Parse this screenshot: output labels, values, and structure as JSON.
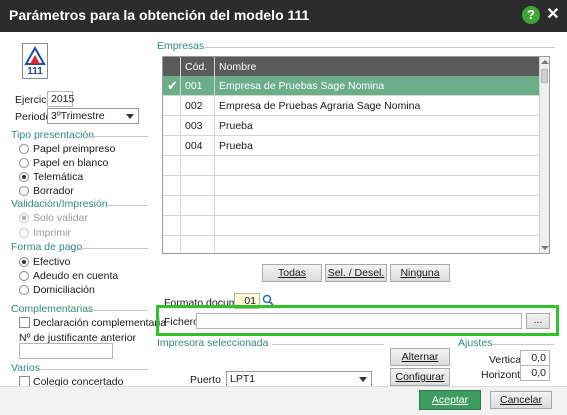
{
  "window": {
    "title": "Parámetros para la obtención del modelo 111"
  },
  "form_logo": {
    "text": "111"
  },
  "ejercicio": {
    "label": "Ejercicio",
    "value": "2015"
  },
  "periodo": {
    "label": "Periodo",
    "value": "3ºTrimestre"
  },
  "tipo_presentacion": {
    "title": "Tipo presentación",
    "options": [
      "Papel preimpreso",
      "Papel en blanco",
      "Telemática",
      "Borrador"
    ],
    "selected": "Telemática"
  },
  "validacion": {
    "title": "Validación/Impresión",
    "options": [
      "Solo validar",
      "Imprimir"
    ],
    "selected": "Solo validar"
  },
  "forma_pago": {
    "title": "Forma de pago",
    "options": [
      "Efectivo",
      "Adeudo en cuenta",
      "Domiciliación"
    ],
    "selected": "Efectivo"
  },
  "complementarias": {
    "title": "Complementarias",
    "declaracion_label": "Declaración complementaria",
    "justificante_label": "Nº de justificante anterior",
    "justificante_value": ""
  },
  "varios": {
    "title": "Varios",
    "colegio_label": "Colegio concertado"
  },
  "empresas": {
    "title": "Empresas",
    "columns": [
      "Cód.",
      "Nombre"
    ],
    "rows": [
      {
        "cod": "001",
        "nombre": "Empresa de Pruebas Sage Nomina",
        "checked": true
      },
      {
        "cod": "002",
        "nombre": "Empresa de Pruebas Agraria Sage Nomina",
        "checked": false
      },
      {
        "cod": "003",
        "nombre": "Prueba",
        "checked": false
      },
      {
        "cod": "004",
        "nombre": "Prueba",
        "checked": false
      }
    ],
    "buttons": {
      "todas": "Todas",
      "sel_desel": "Sel. / Desel.",
      "ninguna": "Ninguna"
    }
  },
  "formato_documento": {
    "label": "Formato documento",
    "value": "01"
  },
  "fichero": {
    "label": "Fichero",
    "value": "",
    "browse_label": "..."
  },
  "impresora": {
    "title": "Impresora seleccionada",
    "puerto_label": "Puerto",
    "puerto_value": "LPT1",
    "alternar_label": "Alternar",
    "configurar_label": "Configurar"
  },
  "ajustes": {
    "title": "Ajustes",
    "vertical_label": "Vertical",
    "vertical_value": "0,0",
    "horizontal_label": "Horizontal",
    "horizontal_value": "0,0"
  },
  "footer": {
    "aceptar_label": "Aceptar",
    "cancelar_label": "Cancelar"
  },
  "colors": {
    "accent": "#2f8a7d",
    "selected_row": "#6cae8a",
    "highlight": "#31c22a",
    "titlebar": "#2c2c2c",
    "aceptar": "#3e9c5f"
  }
}
